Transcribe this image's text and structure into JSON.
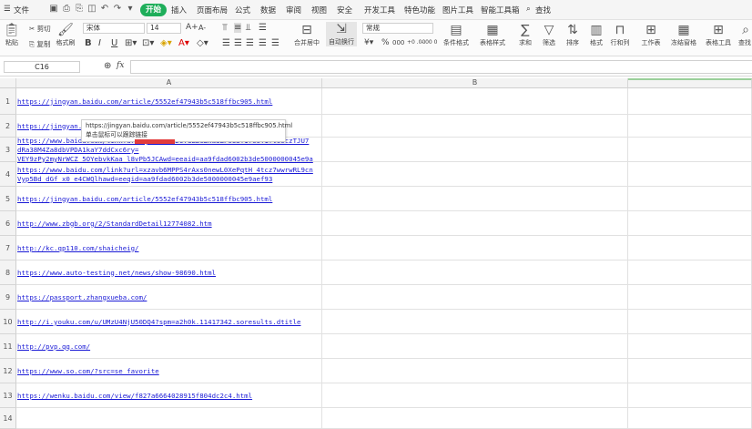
{
  "menubar": {
    "file": "文件",
    "tabs": [
      "开始",
      "插入",
      "页面布局",
      "公式",
      "数据",
      "审阅",
      "视图",
      "安全",
      "开发工具",
      "特色功能",
      "图片工具",
      "智能工具箱"
    ],
    "search": "查找"
  },
  "ribbon": {
    "paste": "粘贴",
    "cut": "剪切",
    "copy": "复制",
    "format_painter": "格式刷",
    "font_name": "宋体",
    "font_size": "14",
    "bold": "B",
    "italic": "I",
    "underline": "U",
    "grow_font": "A+",
    "shrink_font": "A-",
    "merge": "合并居中",
    "wrap": "自动换行",
    "number_format": "常规",
    "percent": "%",
    "thousands": "000",
    "dec_inc": "+0 .00",
    "dec_dec": "-.00 0",
    "cond_format": "条件格式",
    "table_style": "表格样式",
    "sum": "求和",
    "filter": "筛选",
    "sort": "排序",
    "format": "格式",
    "rowcol": "行和列",
    "worksheet": "工作表",
    "freeze": "冻结窗格",
    "table_tools": "表格工具",
    "find": "查找"
  },
  "formula": {
    "cell_ref": "C16",
    "fx": "fx",
    "value": ""
  },
  "grid": {
    "col_a": "A",
    "col_b": "B",
    "rows": [
      {
        "num": "1",
        "lines": [
          "https://jingyan.baidu.com/article/5552ef47943b5c518ffbc905.html"
        ]
      },
      {
        "num": "2",
        "lines": [
          "https://jingyan."
        ]
      },
      {
        "num": "3",
        "lines": [
          "https://www.baidu.com/link?url=qsfw_DOkDOTGLBCZnaiLF0U3T1f6OT1ft60czTJU7",
          "dRa38M4Za8dbVPDA1kaY7ddCxc6ry=",
          "VEY9zPy2myNrWCZ_5OYebvkKaa_l8vPb5JCAwd=eeaid=aa9fdad6002b3de5000000045e9a"
        ]
      },
      {
        "num": "4",
        "lines": [
          "https://www.baidu.com/link?url=xzavb6MPPS4rAxs0newL0XePqtH_4tcz7wwrwRL9cn",
          "Vyp5Bd_dGf_x0_e4CWQlhawd=eeqid=aa9fdad6002b3de5000000045e9aef93"
        ]
      },
      {
        "num": "5",
        "lines": [
          "https://jingyan.baidu.com/article/5552ef47943b5c518ffbc905.html"
        ]
      },
      {
        "num": "6",
        "lines": [
          "http://www.zbgb.org/2/StandardDetail12774082.htm"
        ]
      },
      {
        "num": "7",
        "lines": [
          "http://kc.qp110.com/shaicheig/"
        ]
      },
      {
        "num": "8",
        "lines": [
          "https://www.auto-testing.net/news/show-98690.html"
        ]
      },
      {
        "num": "9",
        "lines": [
          "https://passport.zhangxueba.com/"
        ]
      },
      {
        "num": "10",
        "lines": [
          "http://i.youku.com/u/UMzU4NjU50DQ4?spm=a2h0k.11417342.soresults.dtitle"
        ]
      },
      {
        "num": "11",
        "lines": [
          "http://pvp.qq.com/"
        ]
      },
      {
        "num": "12",
        "lines": [
          "https://www.so.com/?src=se_favorite"
        ]
      },
      {
        "num": "13",
        "lines": [
          "https://wenku.baidu.com/view/f827a6664028915f804dc2c4.html"
        ]
      },
      {
        "num": "14",
        "lines": []
      }
    ]
  },
  "tooltip": {
    "line1": "https://jingyan.baidu.com/article/5552ef47943b5c518ffbc905.html",
    "line2": "单击鼠标可以跟踪链接"
  },
  "colors": {
    "accent": "#1eae5a",
    "link": "#1a1ad6",
    "marker": "#e23b3b"
  },
  "icons": [
    "menu-icon",
    "save-icon",
    "undo-icon",
    "redo-icon",
    "print-icon",
    "search-icon",
    "paste-icon",
    "cut-icon",
    "copy-icon",
    "format-painter-icon",
    "sum-icon",
    "filter-icon",
    "sort-icon",
    "zoom-icon"
  ]
}
